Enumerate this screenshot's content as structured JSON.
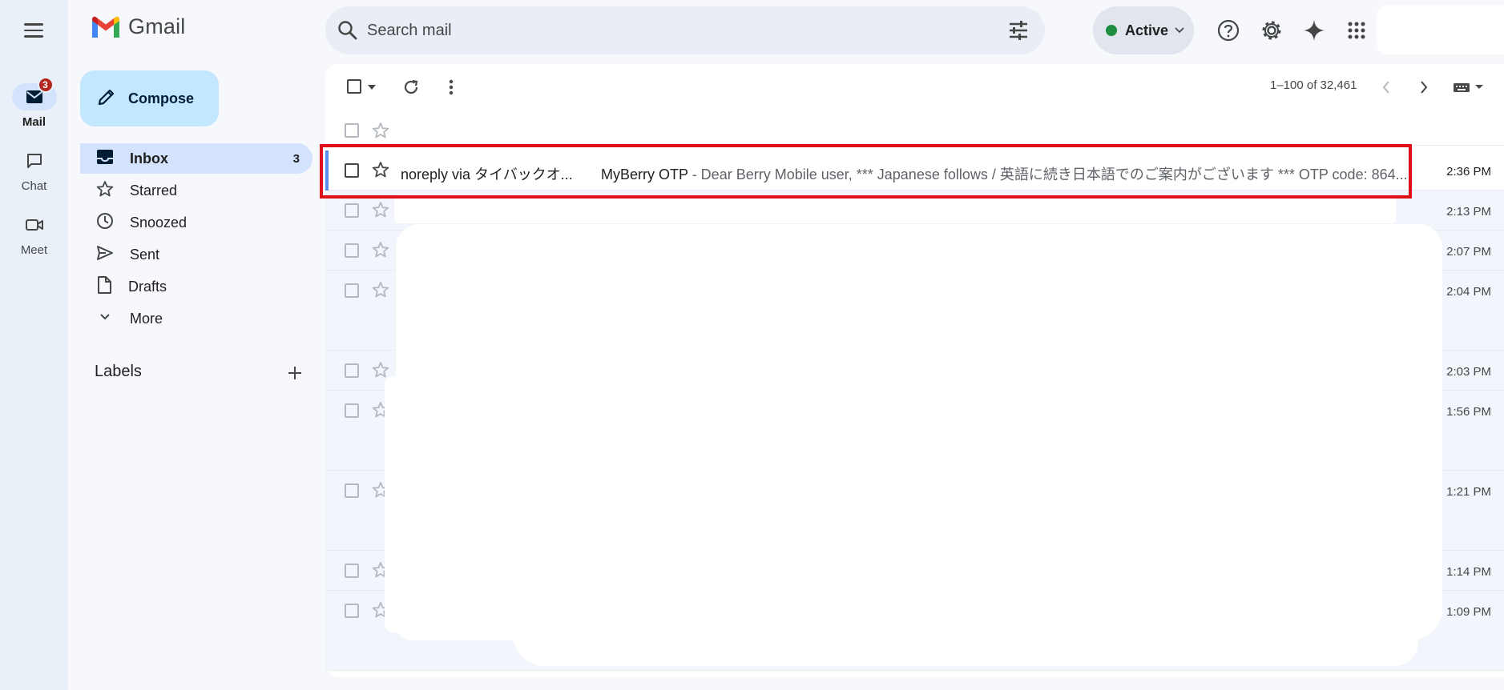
{
  "rail": {
    "items": [
      {
        "label": "Mail",
        "badge": "3"
      },
      {
        "label": "Chat"
      },
      {
        "label": "Meet"
      }
    ]
  },
  "header": {
    "app_name": "Gmail",
    "search_placeholder": "Search mail",
    "status_label": "Active",
    "status_color": "#1e8e3e"
  },
  "sidebar": {
    "compose_label": "Compose",
    "items": [
      {
        "label": "Inbox",
        "count": "3",
        "icon": "inbox-icon"
      },
      {
        "label": "Starred",
        "icon": "star-icon"
      },
      {
        "label": "Snoozed",
        "icon": "clock-icon"
      },
      {
        "label": "Sent",
        "icon": "send-icon"
      },
      {
        "label": "Drafts",
        "icon": "draft-icon"
      },
      {
        "label": "More",
        "icon": "chevron-down-icon"
      }
    ],
    "labels_title": "Labels"
  },
  "toolbar": {
    "pagination": "1–100 of 32,461"
  },
  "emails": [
    {
      "sender": "noreply via タイバックオ...",
      "subject": "MyBerry OTP",
      "snippet": " - Dear Berry Mobile user, *** Japanese follows / 英語に続き日本語でのご案内がございます *** OTP code: 864...",
      "time": "2:36 PM"
    },
    {
      "time": "2:13 PM"
    },
    {
      "time": "2:07 PM"
    },
    {
      "time": "2:04 PM"
    },
    {
      "time": "2:03 PM"
    },
    {
      "time": "1:56 PM"
    },
    {
      "time": "1:21 PM"
    },
    {
      "time": "1:14 PM"
    },
    {
      "time": "1:09 PM"
    }
  ],
  "colors": {
    "accent": "#0b57d0",
    "highlight_border": "#e0101a",
    "badge": "#b3261e"
  }
}
